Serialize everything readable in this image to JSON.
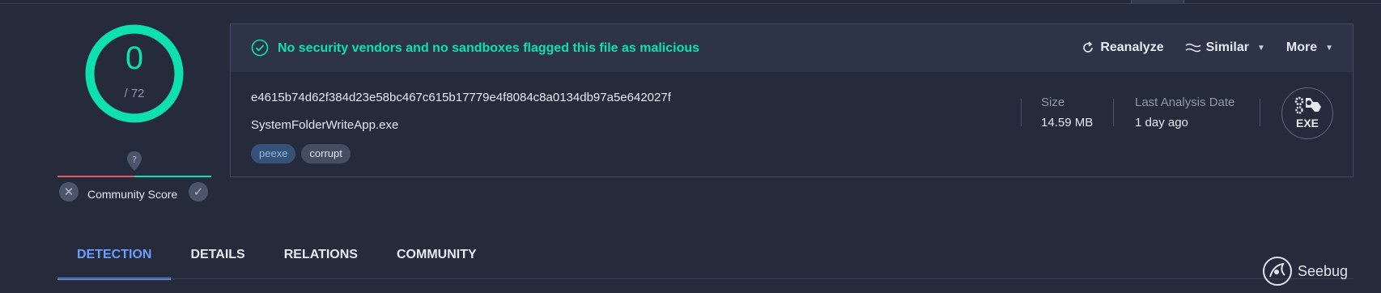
{
  "score": {
    "detections": "0",
    "total": "/ 72",
    "community_label": "Community Score"
  },
  "summary": {
    "verdict": "No security vendors and no sandboxes flagged this file as malicious",
    "actions": {
      "reanalyze": "Reanalyze",
      "similar": "Similar",
      "more": "More"
    }
  },
  "file": {
    "hash": "e4615b74d62f384d23e58bc467c615b17779e4f8084c8a0134db97a5e642027f",
    "name": "SystemFolderWriteApp.exe",
    "tags": [
      "peexe",
      "corrupt"
    ],
    "size_label": "Size",
    "size_value": "14.59 MB",
    "date_label": "Last Analysis Date",
    "date_value": "1 day ago",
    "type_icon_text": "EXE"
  },
  "tabs": [
    "DETECTION",
    "DETAILS",
    "RELATIONS",
    "COMMUNITY"
  ],
  "watermark": "Seebug",
  "colors": {
    "accent_green": "#0ee0b0",
    "accent_blue": "#6d9cff",
    "negative_red": "#e05a6a",
    "background": "#252b3b"
  }
}
